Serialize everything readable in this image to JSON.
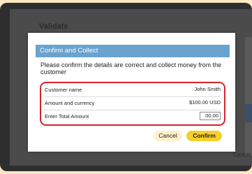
{
  "background": {
    "title": "Validate",
    "cancel_label": "Cancel"
  },
  "dialog": {
    "title": "Confirm and Collect",
    "message": "Please confirm the details are correct and collect money from the customer",
    "rows": [
      {
        "label": "Customer name",
        "value": "John Smith"
      },
      {
        "label": "Amount and currency",
        "value": "$100.00 USD"
      },
      {
        "label": "Enter Total Amount",
        "value": "00.00"
      }
    ],
    "cancel_label": "Cancel",
    "confirm_label": "Confirm"
  },
  "colors": {
    "header": "#6aa3d0",
    "highlight_border": "#d4232c",
    "confirm_button": "#f7cf2b",
    "cancel_button": "#fdf0c8",
    "page_background": "#fde8c2"
  }
}
